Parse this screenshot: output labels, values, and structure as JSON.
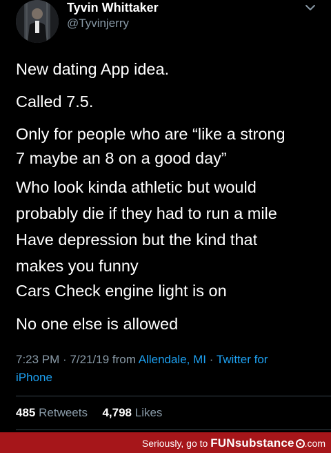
{
  "author": {
    "name": "Tyvin Whittaker",
    "handle": "@Tyvinjerry",
    "avatar_icon": "profile-photo"
  },
  "tweet": {
    "lines": [
      "New dating App idea.",
      "Called 7.5.",
      "Only for people who are “like a strong",
      "7 maybe an 8 on a good day”",
      "Who look kinda athletic but would",
      "probably die if they had to run a mile",
      "Have depression but the kind that",
      "makes you funny",
      "Cars Check engine light is on",
      "No one else is allowed"
    ]
  },
  "meta": {
    "time": "7:23 PM",
    "date": "7/21/19",
    "from_label": "from",
    "location": "Allendale, MI",
    "client_part1": "Twitter for",
    "client_part2": "iPhone",
    "separator": "·"
  },
  "stats": {
    "retweets_count": "485",
    "retweets_label": "Retweets",
    "likes_count": "4,798",
    "likes_label": "Likes"
  },
  "footer": {
    "prefix": "Seriously, go to",
    "brand": "FUNsubstance",
    "suffix": ".com"
  },
  "colors": {
    "background": "#000000",
    "text": "#ffffff",
    "muted": "#8899a6",
    "link": "#1da1f2",
    "footer_bg": "#a6161a"
  }
}
